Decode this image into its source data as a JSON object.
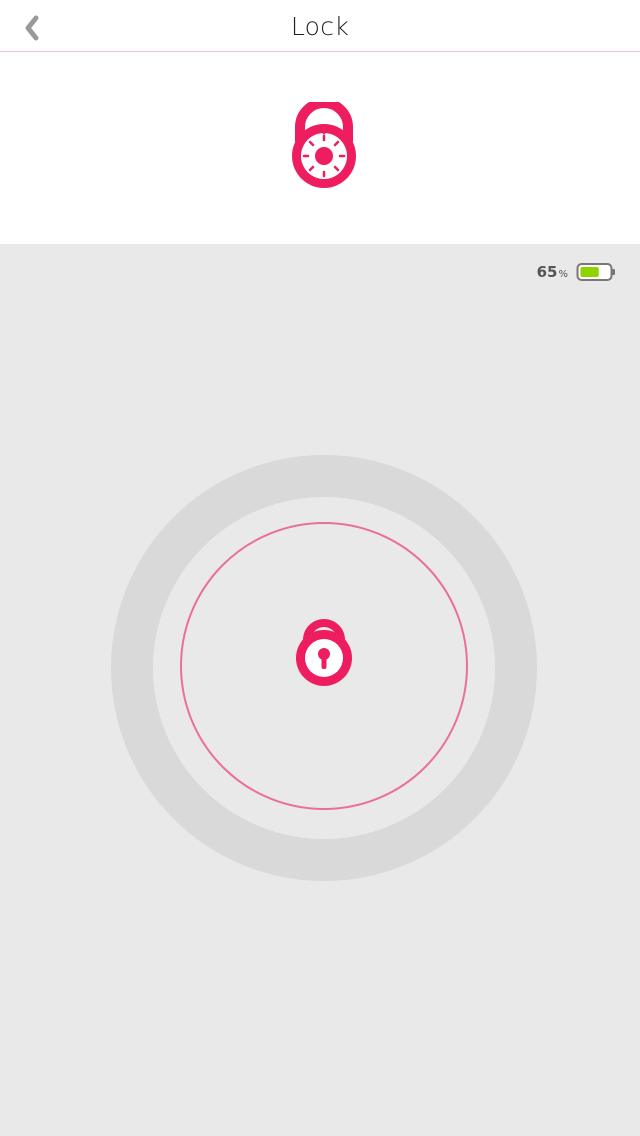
{
  "header": {
    "title": "Lock",
    "back_icon": "chevron-left-icon"
  },
  "top_panel": {
    "icon": "dial-lock-icon"
  },
  "battery": {
    "value": "65",
    "unit": "%",
    "level": 0.65,
    "icon": "battery-icon"
  },
  "lock_control": {
    "icon": "padlock-icon",
    "state": "unlocked"
  },
  "colors": {
    "accent": "#ee1d5f",
    "background": "#e9e9e9",
    "ring": "#d9d9d9",
    "ring_thin": "#ea7096",
    "battery_fill": "#8fd400"
  }
}
